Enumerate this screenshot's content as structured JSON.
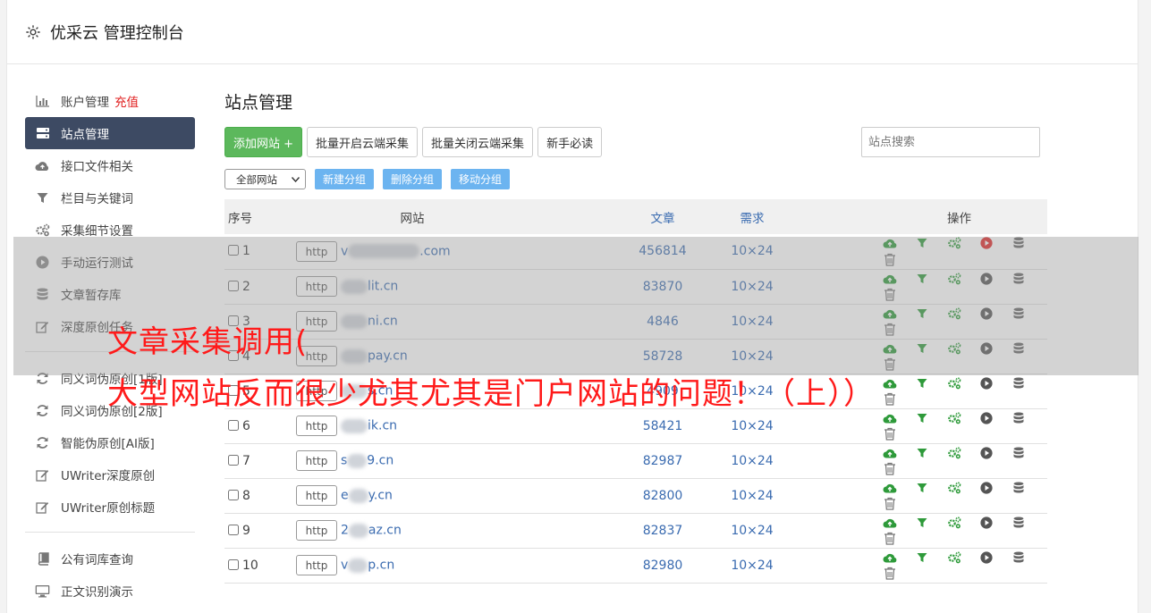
{
  "app": {
    "title": "优采云 管理控制台"
  },
  "sidebar": {
    "items": [
      {
        "label": "账户管理",
        "extra": "充值",
        "icon": "bar-chart-icon"
      },
      {
        "label": "站点管理",
        "icon": "server-icon",
        "active": true
      },
      {
        "label": "接口文件相关",
        "icon": "cloud-upload-icon"
      },
      {
        "label": "栏目与关键词",
        "icon": "filter-icon"
      },
      {
        "label": "采集细节设置",
        "icon": "gears-icon"
      },
      {
        "label": "手动运行测试",
        "icon": "play-circle-icon"
      },
      {
        "label": "文章暂存库",
        "icon": "database-icon"
      },
      {
        "label": "深度原创任务",
        "icon": "edit-icon"
      },
      {
        "label": "同义词伪原创[1版]",
        "icon": "refresh-icon"
      },
      {
        "label": "同义词伪原创[2版]",
        "icon": "refresh-icon"
      },
      {
        "label": "智能伪原创[AI版]",
        "icon": "refresh-icon"
      },
      {
        "label": "UWriter深度原创",
        "icon": "edit-icon"
      },
      {
        "label": "UWriter原创标题",
        "icon": "edit-icon"
      },
      {
        "label": "公有词库查询",
        "icon": "book-icon"
      },
      {
        "label": "正文识别演示",
        "icon": "monitor-icon"
      }
    ]
  },
  "main": {
    "title": "站点管理",
    "buttons": {
      "add": "添加网站 +",
      "batch_on": "批量开启云端采集",
      "batch_off": "批量关闭云端采集",
      "newbie": "新手必读"
    },
    "search_placeholder": "站点搜索",
    "group_select": "全部网站",
    "group_buttons": {
      "new": "新建分组",
      "delete": "删除分组",
      "move": "移动分组"
    },
    "table": {
      "headers": {
        "no": "序号",
        "site": "网站",
        "articles": "文章",
        "demand": "需求",
        "ops": "操作"
      },
      "http_label": "http",
      "rows": [
        {
          "no": "1",
          "pre": "v",
          "domain": ".com",
          "articles": "456814",
          "demand": "10×24",
          "running": true
        },
        {
          "no": "2",
          "pre": "",
          "domain": "lit.cn",
          "articles": "83870",
          "demand": "10×24",
          "running": false
        },
        {
          "no": "3",
          "pre": "",
          "domain": "ni.cn",
          "articles": "4846",
          "demand": "10×24",
          "running": false
        },
        {
          "no": "4",
          "pre": "",
          "domain": "pay.cn",
          "articles": "58728",
          "demand": "10×24",
          "running": false
        },
        {
          "no": "5",
          "pre": "",
          "domain": "s.cn",
          "articles": "4909",
          "demand": "10×24",
          "running": false
        },
        {
          "no": "6",
          "pre": "",
          "domain": "ik.cn",
          "articles": "58421",
          "demand": "10×24",
          "running": false
        },
        {
          "no": "7",
          "pre": "s",
          "domain": "9.cn",
          "articles": "82987",
          "demand": "10×24",
          "running": false
        },
        {
          "no": "8",
          "pre": "e",
          "domain": "y.cn",
          "articles": "82800",
          "demand": "10×24",
          "running": false
        },
        {
          "no": "9",
          "pre": "2",
          "domain": "az.cn",
          "articles": "82837",
          "demand": "10×24",
          "running": false
        },
        {
          "no": "10",
          "pre": "v",
          "domain": "p.cn",
          "articles": "82980",
          "demand": "10×24",
          "running": false
        }
      ]
    }
  },
  "overlay": {
    "line1": "文章采集调用(",
    "line2": "大型网站反而很少尤其尤其是门户网站的问题！（上））"
  },
  "colors": {
    "accent": "#3d4a63",
    "green": "#5cb85c",
    "link": "#3a6bb0",
    "red_text": "#ff1a1a"
  }
}
